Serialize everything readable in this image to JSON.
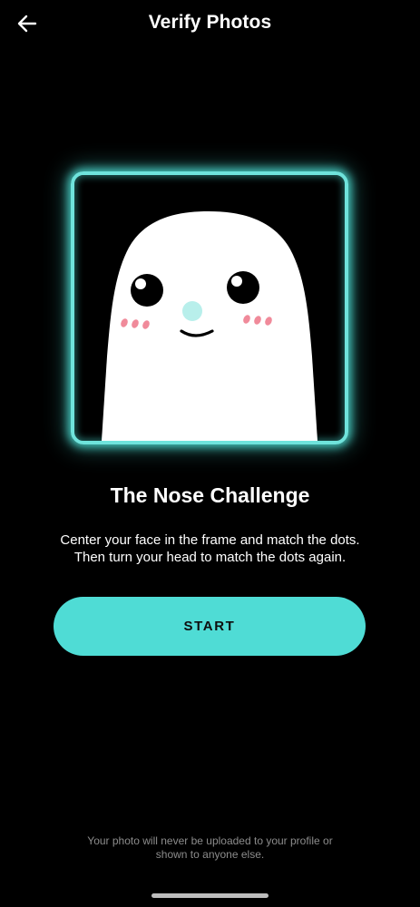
{
  "header": {
    "title": "Verify Photos",
    "back_icon": "arrow-left-icon"
  },
  "illustration": {
    "description_icon": "ghost-face-icon",
    "frame_color": "#4de0d6",
    "nose_color": "#b8efeb",
    "blush_color": "#f08a9a"
  },
  "challenge": {
    "title": "The Nose Challenge",
    "instruction_line1": "Center your face in the frame and match the dots.",
    "instruction_line2": "Then turn your head to match the dots again."
  },
  "start_button": {
    "label": "START",
    "color": "#4fdcd5"
  },
  "footer": {
    "note_line1": "Your photo will never be uploaded to your profile or",
    "note_line2": "shown to anyone else."
  }
}
